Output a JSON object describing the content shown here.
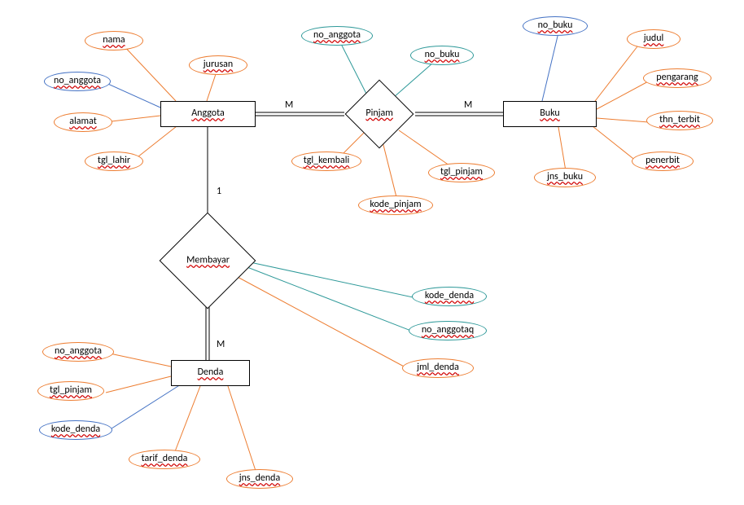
{
  "entities": {
    "anggota": {
      "label": "Anggota"
    },
    "buku": {
      "label": "Buku"
    },
    "denda": {
      "label": "Denda"
    }
  },
  "relationships": {
    "pinjam": {
      "label": "Pinjam"
    },
    "membayar": {
      "label": "Membayar"
    }
  },
  "cardinalities": {
    "anggota_pinjam": "M",
    "buku_pinjam": "M",
    "anggota_membayar": "1",
    "denda_membayar": "M"
  },
  "attributes": {
    "anggota": {
      "nama": {
        "label": "nama",
        "style": "orange"
      },
      "no_anggota": {
        "label": "no_anggota",
        "style": "blue"
      },
      "alamat": {
        "label": "alamat",
        "style": "orange"
      },
      "tgl_lahir": {
        "label": "tgl_lahir",
        "style": "orange"
      },
      "jurusan": {
        "label": "jurusan",
        "style": "orange"
      }
    },
    "pinjam": {
      "no_anggota": {
        "label": "no_anggota",
        "style": "teal"
      },
      "no_buku": {
        "label": "no_buku",
        "style": "teal"
      },
      "tgl_kembali": {
        "label": "tgl_kembali",
        "style": "orange"
      },
      "tgl_pinjam": {
        "label": "tgl_pinjam",
        "style": "orange"
      },
      "kode_pinjam": {
        "label": "kode_pinjam",
        "style": "orange"
      }
    },
    "buku": {
      "no_buku": {
        "label": "no_buku",
        "style": "blue"
      },
      "judul": {
        "label": "judul",
        "style": "orange"
      },
      "pengarang": {
        "label": "pengarang",
        "style": "orange"
      },
      "thn_terbit": {
        "label": "thn_terbit",
        "style": "orange"
      },
      "penerbit": {
        "label": "penerbit",
        "style": "orange"
      },
      "jns_buku": {
        "label": "jns_buku",
        "style": "orange"
      }
    },
    "membayar": {
      "kode_denda": {
        "label": "kode_denda",
        "style": "teal"
      },
      "no_anggotaq": {
        "label": "no_anggotaq",
        "style": "teal"
      },
      "jml_denda": {
        "label": "jml_denda",
        "style": "orange"
      }
    },
    "denda": {
      "no_anggota": {
        "label": "no_anggota",
        "style": "orange"
      },
      "tgl_pinjam": {
        "label": "tgl_pinjam",
        "style": "orange"
      },
      "kode_denda": {
        "label": "kode_denda",
        "style": "blue"
      },
      "tarif_denda": {
        "label": "tarif_denda",
        "style": "orange"
      },
      "jns_denda": {
        "label": "jns_denda",
        "style": "orange"
      }
    }
  }
}
